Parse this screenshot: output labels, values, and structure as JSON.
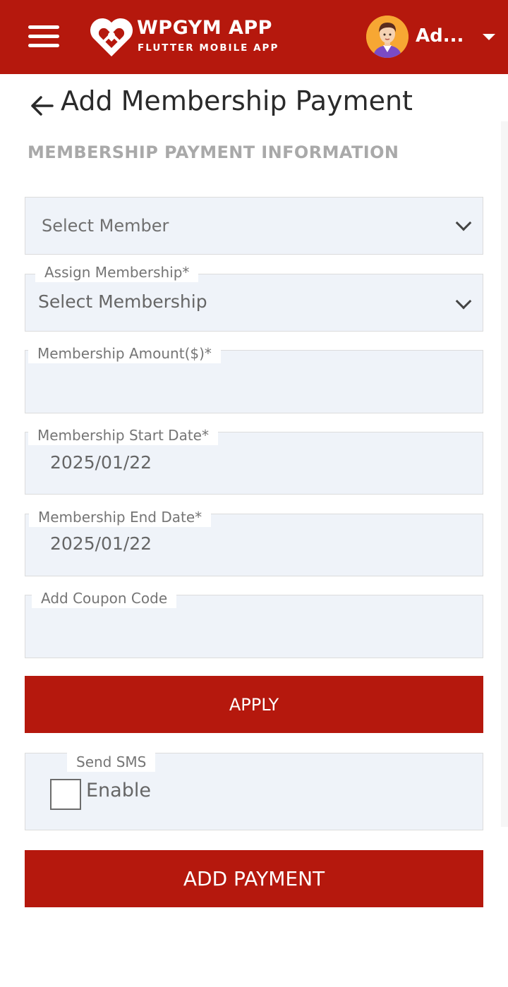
{
  "header": {
    "brand_title": "WPGYM APP",
    "brand_subtitle": "FLUTTER MOBILE APP",
    "user_name": "Ad...",
    "bar_color": "#b5180d",
    "menu_icon": "hamburger-menu-icon"
  },
  "page": {
    "title": "Add Membership Payment",
    "section_title": "MEMBERSHIP PAYMENT INFORMATION"
  },
  "form": {
    "member_select": {
      "value": "Select Member"
    },
    "membership_select": {
      "label": "Assign Membership*",
      "value": "Select Membership"
    },
    "amount": {
      "label": "Membership Amount($)*",
      "value": ""
    },
    "start_date": {
      "label": "Membership Start Date*",
      "value": "2025/01/22"
    },
    "end_date": {
      "label": "Membership End Date*",
      "value": "2025/01/22"
    },
    "coupon": {
      "label": "Add Coupon Code",
      "value": ""
    },
    "apply_label": "APPLY",
    "sms": {
      "label": "Send SMS",
      "checkbox_label": "Enable",
      "checked": false
    },
    "submit_label": "ADD PAYMENT"
  }
}
